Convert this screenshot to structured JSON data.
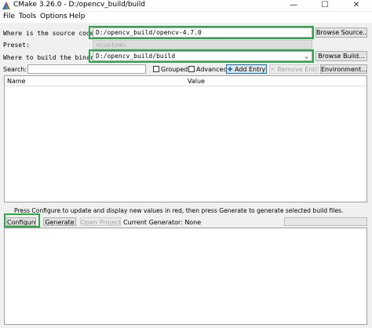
{
  "window": {
    "title": "CMake 3.26.0 - D:/opencv_build/build",
    "minimize": "—",
    "maximize": "☐",
    "close": "✕"
  },
  "menu": [
    "File",
    "Tools",
    "Options",
    "Help"
  ],
  "source": {
    "label": "Where is the source code:",
    "value": "D:/opencv_build/opencv-4.7.0",
    "browse": "Browse Source..."
  },
  "preset": {
    "label": "Preset:",
    "value": "<custom>"
  },
  "binaries": {
    "label": "Where to build the binaries:",
    "value": "D:/opencv_build/build",
    "browse": "Browse Build..."
  },
  "search": {
    "label": "Search:",
    "value": ""
  },
  "toolbar": {
    "grouped": "Grouped",
    "advanced": "Advanced",
    "add_entry": "Add Entry",
    "remove_entry": "Remove Entry",
    "environment": "Environment..."
  },
  "table": {
    "columns": [
      "Name",
      "Value"
    ]
  },
  "hint": "Press Configure to update and display new values in red, then press Generate to generate selected build files.",
  "actions": {
    "configure": "Configure",
    "generate": "Generate",
    "open_project": "Open Project",
    "current_generator": "Current Generator: None"
  },
  "colors": {
    "highlight": "#2aa84a",
    "accent": "#0066cc"
  }
}
